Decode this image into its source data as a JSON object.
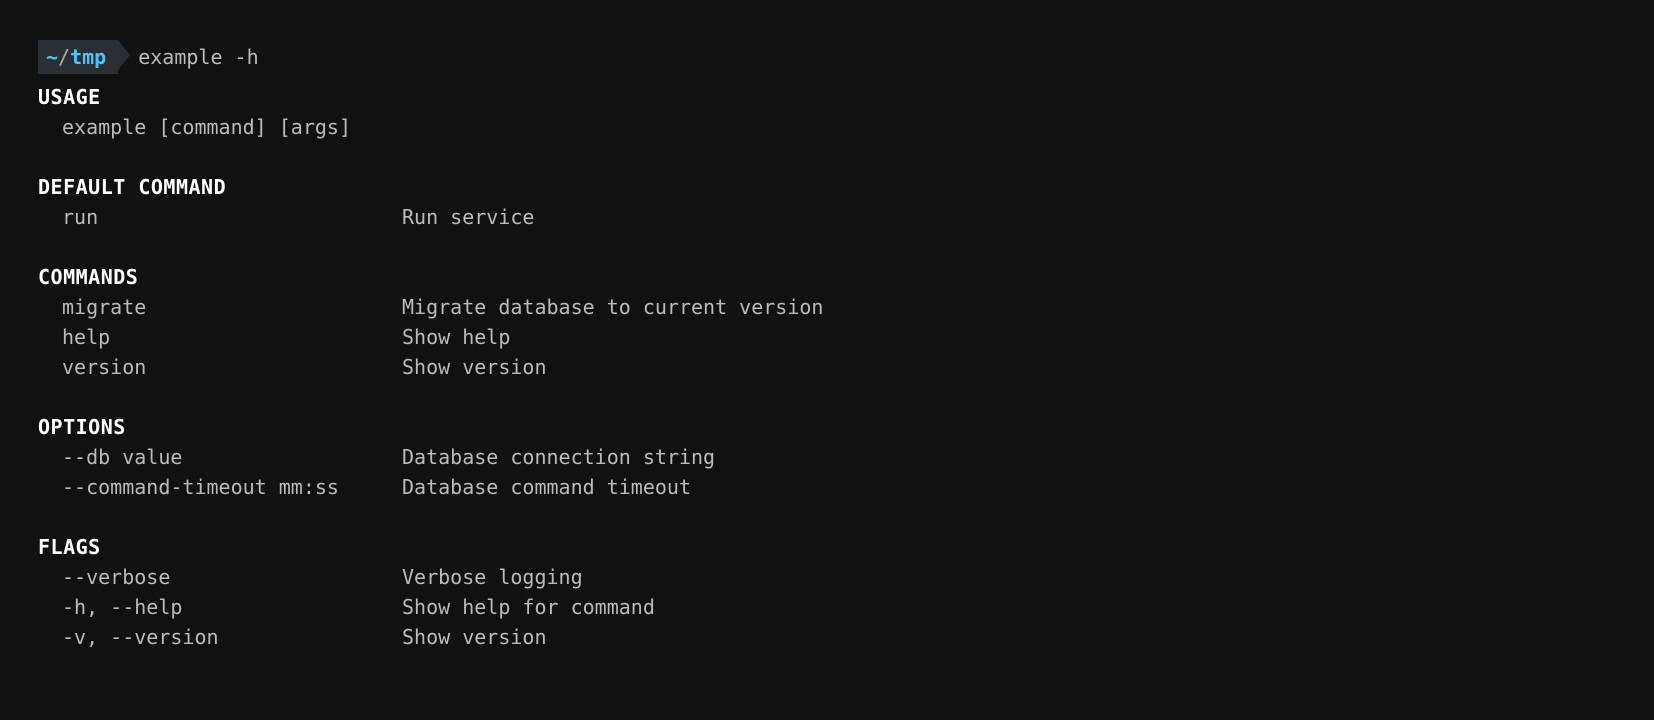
{
  "prompt": {
    "tilde": "~",
    "slash": "/",
    "dir": "tmp",
    "command": "example -h"
  },
  "sections": {
    "usage": {
      "heading": "USAGE",
      "text": "example [command] [args]"
    },
    "default_command": {
      "heading": "DEFAULT COMMAND",
      "items": [
        {
          "name": "run",
          "desc": "Run service"
        }
      ]
    },
    "commands": {
      "heading": "COMMANDS",
      "items": [
        {
          "name": "migrate",
          "desc": "Migrate database to current version"
        },
        {
          "name": "help",
          "desc": "Show help"
        },
        {
          "name": "version",
          "desc": "Show version"
        }
      ]
    },
    "options": {
      "heading": "OPTIONS",
      "items": [
        {
          "name": "--db value",
          "desc": "Database connection string"
        },
        {
          "name": "--command-timeout mm:ss",
          "desc": "Database command timeout"
        }
      ]
    },
    "flags": {
      "heading": "FLAGS",
      "items": [
        {
          "name": "--verbose",
          "desc": "Verbose logging"
        },
        {
          "name": "-h, --help",
          "desc": "Show help for command"
        },
        {
          "name": "-v, --version",
          "desc": "Show version"
        }
      ]
    }
  }
}
